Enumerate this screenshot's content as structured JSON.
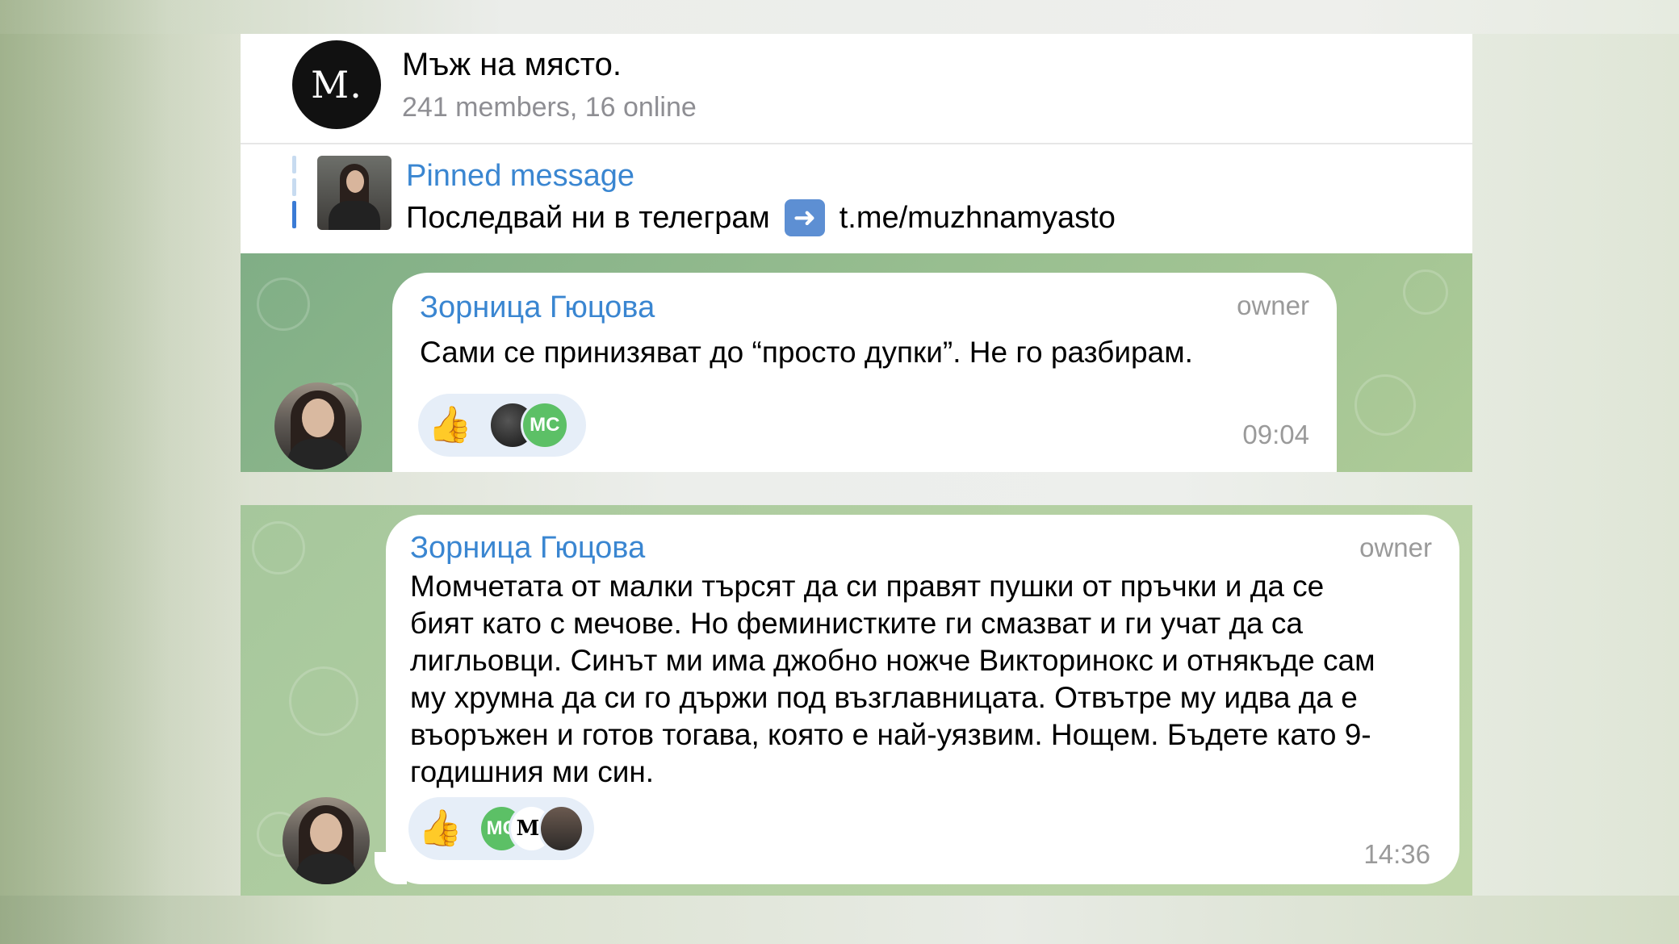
{
  "chat": {
    "avatar_letter": "M.",
    "title": "Мъж на място.",
    "subtitle": "241 members, 16 online"
  },
  "pinned": {
    "label": "Pinned message",
    "text": "Последвай ни в телеграм",
    "arrow_icon": "➡️",
    "link": "t.me/muzhnamyasto"
  },
  "messages": [
    {
      "sender": "Зорница Гюцова",
      "role": "owner",
      "text": "Сами се принизяват до “просто дупки”. Не го разбирам.",
      "time": "09:04",
      "reaction_emoji": "👍",
      "reactor_initials": [
        "",
        "МС"
      ]
    },
    {
      "sender": "Зорница Гюцова",
      "role": "owner",
      "text_lines": [
        "Момчетата от малки търсят да си правят пушки от пръчки и да се",
        "бият като с мечове. Но феминистките ги смазват и ги учат да са",
        "лигльовци. Синът ми има джобно ножче Викторинокс и отнякъде сам",
        "му хрумна да си го държи под възглавницата. Отвътре му идва да е",
        "въоръжен и готов тогава, която е най-уязвим. Нощем. Бъдете като 9-",
        "годишния ми син."
      ],
      "time": "14:36",
      "reaction_emoji": "👍",
      "reactor_initials": [
        "МС",
        "M.",
        ""
      ]
    }
  ],
  "colors": {
    "accent": "#3a86d1",
    "reaction_bg": "#e6eef8",
    "avatar_green": "#5cc066"
  }
}
